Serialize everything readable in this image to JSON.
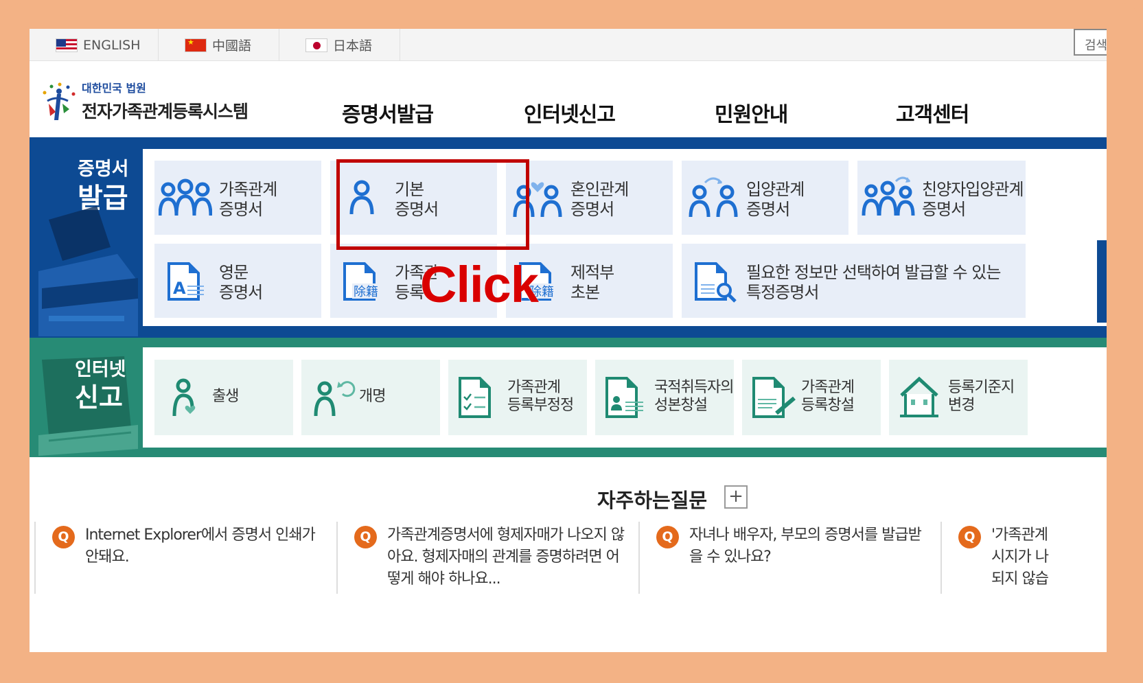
{
  "langbar": {
    "items": [
      {
        "label": "ENGLISH",
        "flag": "us-flag-icon"
      },
      {
        "label": "中國語",
        "flag": "cn-flag-icon"
      },
      {
        "label": "日本語",
        "flag": "jp-flag-icon"
      }
    ],
    "search_label": "검색"
  },
  "header": {
    "logo_small": "대한민국 법원",
    "logo_big": "전자가족관계등록시스템",
    "nav": [
      "증명서발급",
      "인터넷신고",
      "민원안내",
      "고객센터"
    ]
  },
  "cert": {
    "side_line1": "증명서",
    "side_line2": "발급",
    "tiles": [
      {
        "line1": "가족관계",
        "line2": "증명서",
        "icon": "family-icon"
      },
      {
        "line1": "기본",
        "line2": "증명서",
        "icon": "person-icon"
      },
      {
        "line1": "혼인관계",
        "line2": "증명서",
        "icon": "marriage-icon"
      },
      {
        "line1": "입양관계",
        "line2": "증명서",
        "icon": "adoption-icon"
      },
      {
        "line1": "친양자입양관계",
        "line2": "증명서",
        "icon": "full-adoption-icon"
      },
      {
        "line1": "영문",
        "line2": "증명서",
        "icon": "english-document-icon"
      },
      {
        "line1": "가족관",
        "line2": "등록",
        "icon": "removed-document-icon"
      },
      {
        "line1": "제적부",
        "line2": "초본",
        "icon": "removed-register-icon"
      },
      {
        "line1": "필요한 정보만 선택하여 발급할 수 있는",
        "line2": "특정증명서",
        "icon": "search-document-icon"
      }
    ]
  },
  "report": {
    "side_line1": "인터넷",
    "side_line2": "신고",
    "tiles": [
      {
        "line1": "출생",
        "line2": "",
        "icon": "birth-icon"
      },
      {
        "line1": "개명",
        "line2": "",
        "icon": "rename-icon"
      },
      {
        "line1": "가족관계",
        "line2": "등록부정정",
        "icon": "checklist-document-icon"
      },
      {
        "line1": "국적취득자의",
        "line2": "성본창설",
        "icon": "id-document-icon"
      },
      {
        "line1": "가족관계",
        "line2": "등록창설",
        "icon": "pen-document-icon"
      },
      {
        "line1": "등록기준지",
        "line2": "변경",
        "icon": "house-icon"
      }
    ]
  },
  "annotation": {
    "click_label": "Click"
  },
  "faq": {
    "title": "자주하는질문",
    "plus": "+",
    "badge": "Q",
    "items": [
      "Internet Explorer에서 증명서 인쇄가 안돼요.",
      "가족관계증명서에 형제자매가 나오지 않아요. 형제자매의 관계를 증명하려면 어떻게 해야 하나요...",
      "자녀나 배우자, 부모의 증명서를 발급받을 수 있나요?",
      "'가족관계 시지가 나 되지 않습"
    ]
  },
  "colors": {
    "cert_blue": "#0d4a93",
    "report_green": "#278b75",
    "highlight_red": "#c00000",
    "frame_orange": "#f3b285"
  }
}
